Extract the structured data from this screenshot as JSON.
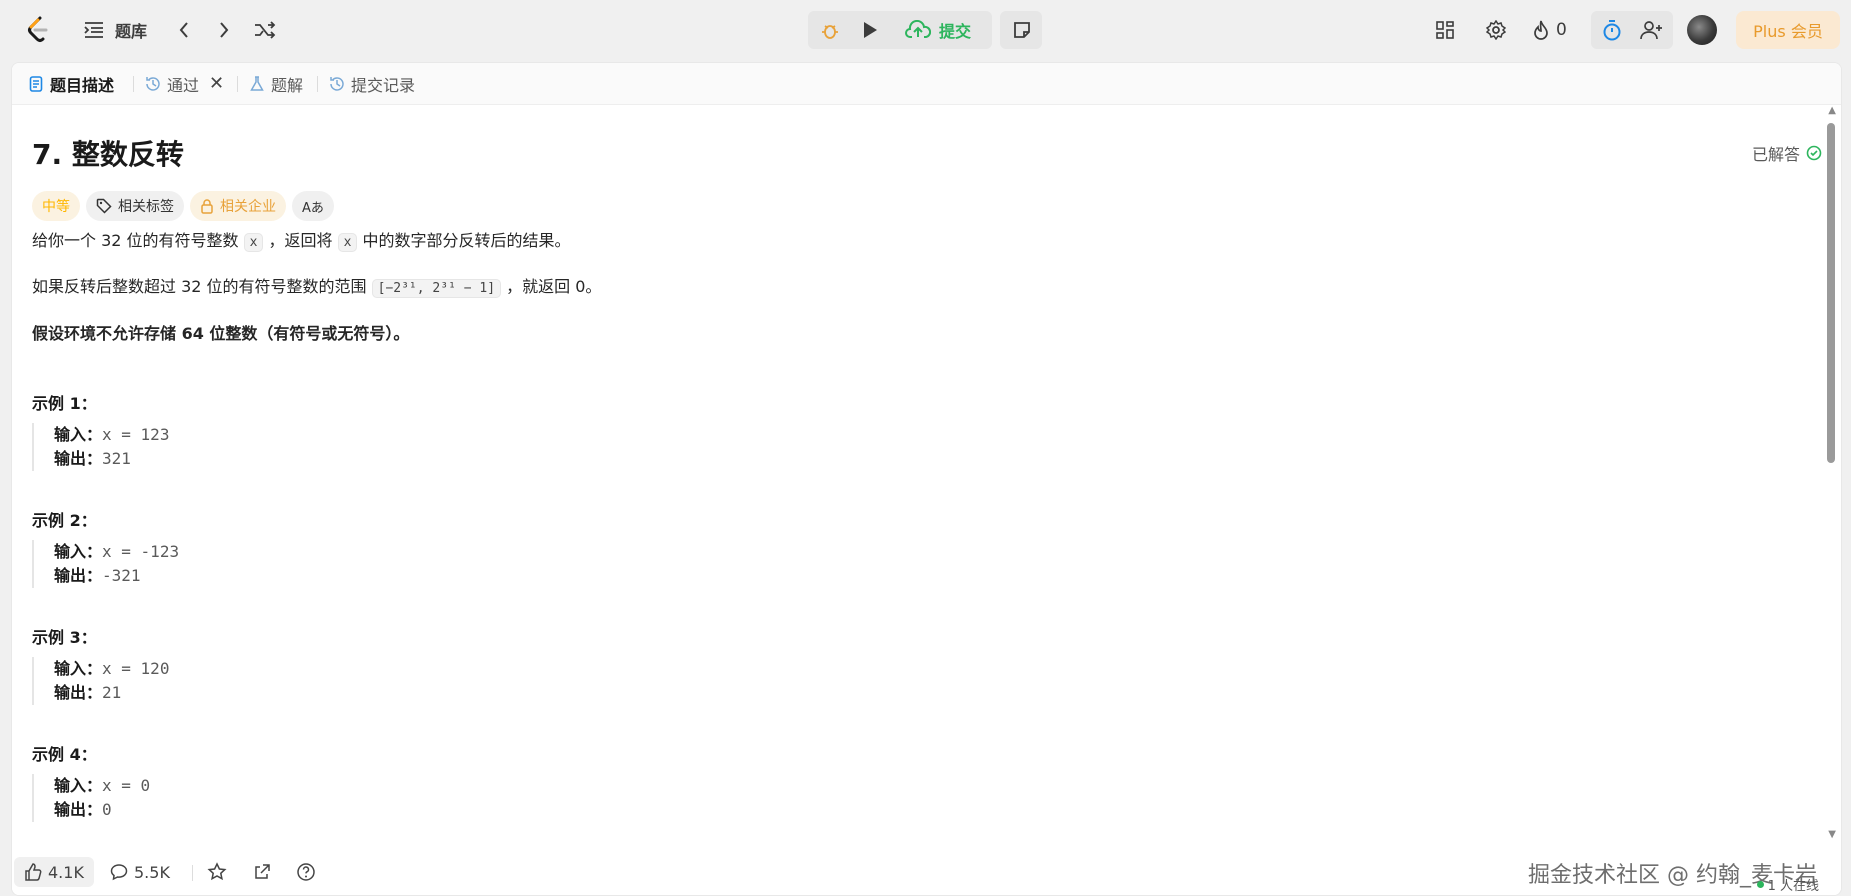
{
  "topbar": {
    "problemset_label": "题库",
    "submit_label": "提交",
    "streak_count": "0",
    "plus_label": "Plus 会员"
  },
  "tabs": [
    {
      "label": "题目描述"
    },
    {
      "label": "通过"
    },
    {
      "label": "题解"
    },
    {
      "label": "提交记录"
    }
  ],
  "problem": {
    "title": "7. 整数反转",
    "solved_label": "已解答",
    "tags": {
      "difficulty": "中等",
      "related_tags": "相关标签",
      "related_companies": "相关企业",
      "translate": "Aあ"
    },
    "p1": {
      "a": "给你一个 32 位的有符号整数 ",
      "code1": "x",
      "b": " ，返回将 ",
      "code2": "x",
      "c": " 中的数字部分反转后的结果。"
    },
    "p2": {
      "a": "如果反转后整数超过 32 位的有符号整数的范围 ",
      "code": "[−2³¹,  2³¹ − 1]",
      "b": " ，就返回 0。"
    },
    "p3": "假设环境不允许存储 64 位整数（有符号或无符号）。",
    "examples": [
      {
        "title": "示例 1：",
        "in_label": "输入：",
        "in": "x = 123",
        "out_label": "输出：",
        "out": "321"
      },
      {
        "title": "示例 2：",
        "in_label": "输入：",
        "in": "x = -123",
        "out_label": "输出：",
        "out": "-321"
      },
      {
        "title": "示例 3：",
        "in_label": "输入：",
        "in": "x = 120",
        "out_label": "输出：",
        "out": "21"
      },
      {
        "title": "示例 4：",
        "in_label": "输入：",
        "in": "x = 0",
        "out_label": "输出：",
        "out": "0"
      }
    ]
  },
  "bottombar": {
    "likes": "4.1K",
    "comments": "5.5K",
    "watermark": "掘金技术社区 @ 约翰_麦卡岩",
    "online": "1 人在线"
  }
}
